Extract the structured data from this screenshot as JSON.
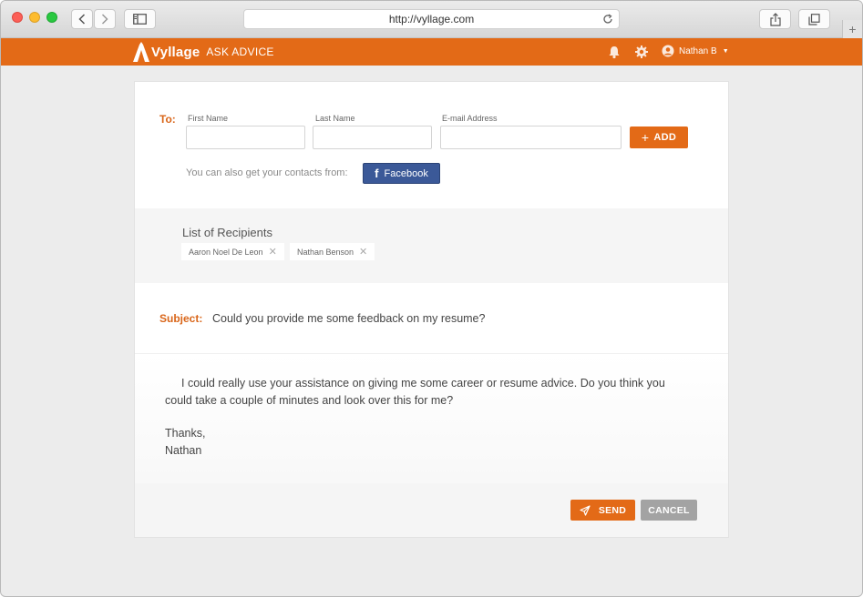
{
  "browser": {
    "url": "http://vyllage.com",
    "new_tab_glyph": "+"
  },
  "app": {
    "brand_name": "Vyllage",
    "section_title": "ASK ADVICE",
    "user_name": "Nathan B",
    "user_caret": "▼",
    "accent_color": "#e36a17"
  },
  "to_section": {
    "label": "To:",
    "first_name_label": "First Name",
    "last_name_label": "Last Name",
    "email_label": "E-mail Address",
    "first_name_value": "",
    "last_name_value": "",
    "email_value": "",
    "add_label": "ADD",
    "add_icon": "+",
    "contacts_text": "You can also get your contacts from:",
    "facebook_icon": "f",
    "facebook_label": "Facebook",
    "facebook_color": "#3b5998"
  },
  "recipients": {
    "title": "List of Recipients",
    "remove_glyph": "✕",
    "items": [
      {
        "name": "Aaron Noel De Leon"
      },
      {
        "name": "Nathan Benson"
      }
    ]
  },
  "subject": {
    "label": "Subject:",
    "value": "Could you provide me some feedback on my resume?"
  },
  "message": {
    "body": "I could really use your assistance on giving me some career or resume advice. Do you think you could take a couple of minutes and look over this for me?",
    "closing": "Thanks,",
    "signature": "Nathan"
  },
  "actions": {
    "send_label": "SEND",
    "cancel_label": "CANCEL"
  }
}
